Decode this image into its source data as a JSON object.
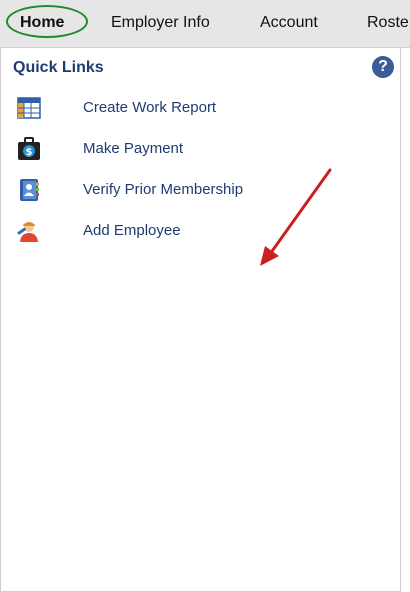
{
  "nav": {
    "tabs": [
      {
        "label": "Home",
        "selected": true
      },
      {
        "label": "Employer Info"
      },
      {
        "label": "Account"
      },
      {
        "label": "Roste"
      }
    ]
  },
  "quick_links": {
    "title": "Quick Links",
    "help_glyph": "?",
    "items": [
      {
        "label": "Create Work Report",
        "icon": "spreadsheet-icon"
      },
      {
        "label": "Make Payment",
        "icon": "briefcase-dollar-icon"
      },
      {
        "label": "Verify Prior Membership",
        "icon": "address-book-icon"
      },
      {
        "label": "Add Employee",
        "icon": "worker-icon"
      }
    ]
  },
  "colors": {
    "link": "#1f3b73",
    "highlight_circle": "#1f8a2e",
    "annotation_arrow": "#cc1f1f"
  }
}
